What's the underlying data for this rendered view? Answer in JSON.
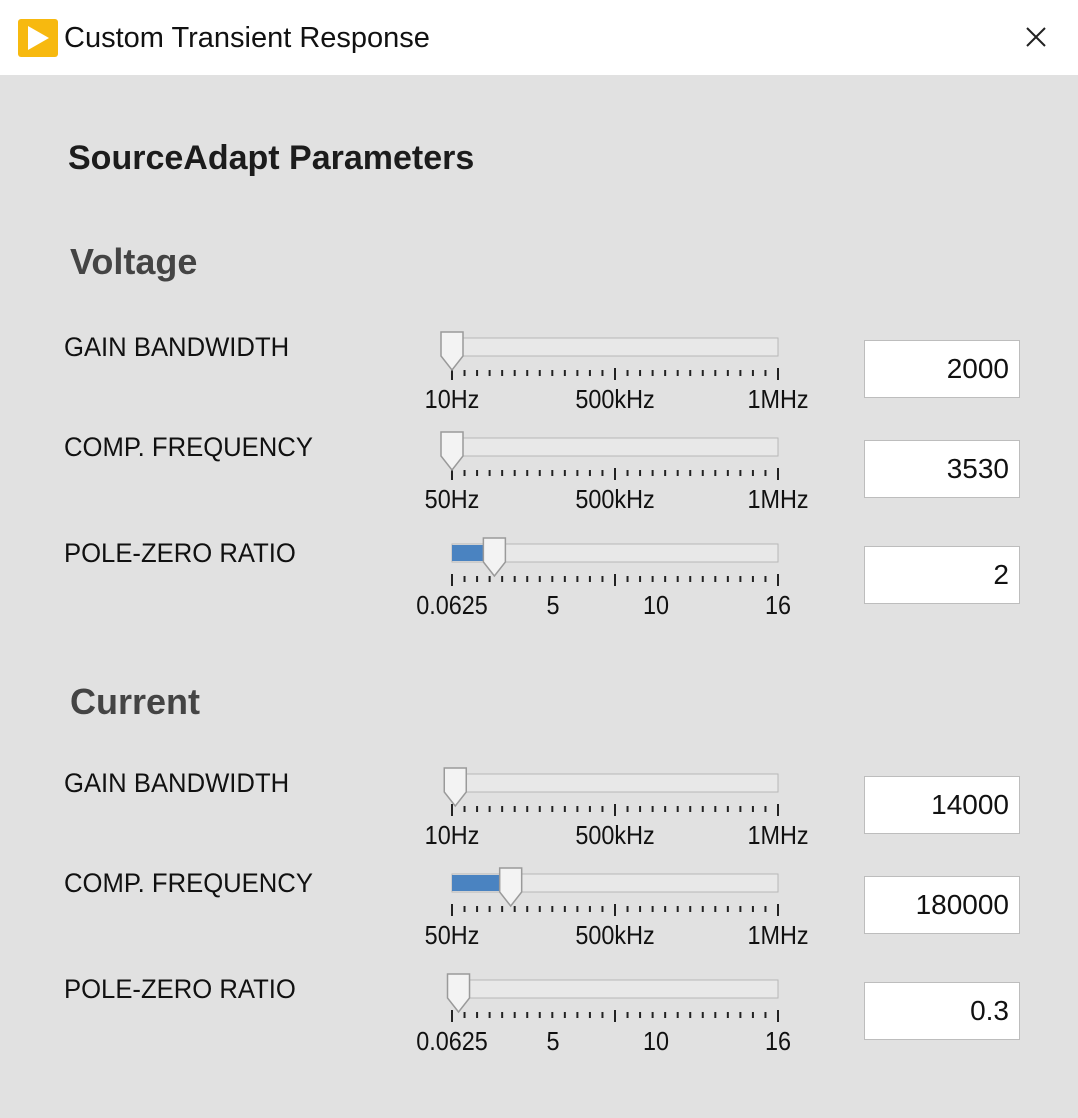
{
  "window": {
    "title": "Custom Transient Response",
    "icon": "labview-play-icon"
  },
  "heading": "SourceAdapt Parameters",
  "colors": {
    "fill": "#4a83c1",
    "track": "#e8e8e8",
    "accent": "#f7b90f"
  },
  "sections": [
    {
      "title": "Voltage",
      "params": [
        {
          "label": "GAIN BANDWIDTH",
          "value": "2000",
          "position": 0.0,
          "ticks": [
            "10Hz",
            "500kHz",
            "1MHz"
          ]
        },
        {
          "label": "COMP. FREQUENCY",
          "value": "3530",
          "position": 0.0,
          "ticks": [
            "50Hz",
            "500kHz",
            "1MHz"
          ]
        },
        {
          "label": "POLE-ZERO RATIO",
          "value": "2",
          "position": 0.13,
          "ticks": [
            "0.0625",
            "5",
            "10",
            "16"
          ]
        }
      ]
    },
    {
      "title": "Current",
      "params": [
        {
          "label": "GAIN BANDWIDTH",
          "value": "14000",
          "position": 0.01,
          "ticks": [
            "10Hz",
            "500kHz",
            "1MHz"
          ]
        },
        {
          "label": "COMP. FREQUENCY",
          "value": "180000",
          "position": 0.18,
          "ticks": [
            "50Hz",
            "500kHz",
            "1MHz"
          ]
        },
        {
          "label": "POLE-ZERO RATIO",
          "value": "0.3",
          "position": 0.02,
          "ticks": [
            "0.0625",
            "5",
            "10",
            "16"
          ]
        }
      ]
    }
  ]
}
